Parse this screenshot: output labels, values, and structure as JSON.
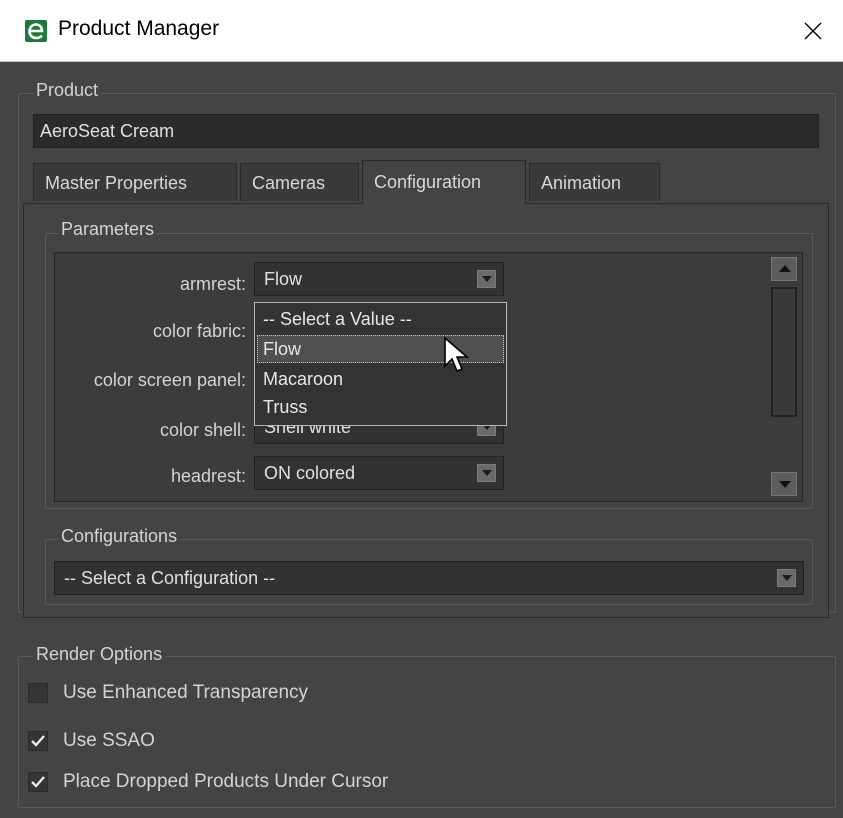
{
  "window": {
    "title": "Product Manager",
    "icon": "e-logo-icon",
    "close_label": "✕"
  },
  "product": {
    "legend": "Product",
    "name": "AeroSeat Cream"
  },
  "tabs": [
    {
      "label": "Master Properties",
      "active": false
    },
    {
      "label": "Cameras",
      "active": false
    },
    {
      "label": "Configuration",
      "active": true
    },
    {
      "label": "Animation",
      "active": false
    }
  ],
  "parameters": {
    "legend": "Parameters",
    "rows": [
      {
        "label": "armrest:",
        "value": "Flow"
      },
      {
        "label": "color fabric:",
        "value": ""
      },
      {
        "label": "color screen panel:",
        "value": ""
      },
      {
        "label": "color shell:",
        "value": "Shell white"
      },
      {
        "label": "headrest:",
        "value": "ON colored"
      }
    ],
    "dropdown_open_for": "armrest",
    "dropdown_options": [
      "-- Select a Value --",
      "Flow",
      "Macaroon",
      "Truss"
    ],
    "dropdown_hover": "Flow"
  },
  "configurations": {
    "legend": "Configurations",
    "value": "-- Select a Configuration --"
  },
  "render_options": {
    "legend": "Render Options",
    "items": [
      {
        "label": "Use Enhanced Transparency",
        "checked": false
      },
      {
        "label": "Use SSAO",
        "checked": true
      },
      {
        "label": "Place Dropped Products Under Cursor",
        "checked": true
      }
    ]
  },
  "colors": {
    "background": "#444444",
    "field": "#2b2b2b",
    "text": "#d8d8d8",
    "icon_green": "#1e7a3c"
  }
}
